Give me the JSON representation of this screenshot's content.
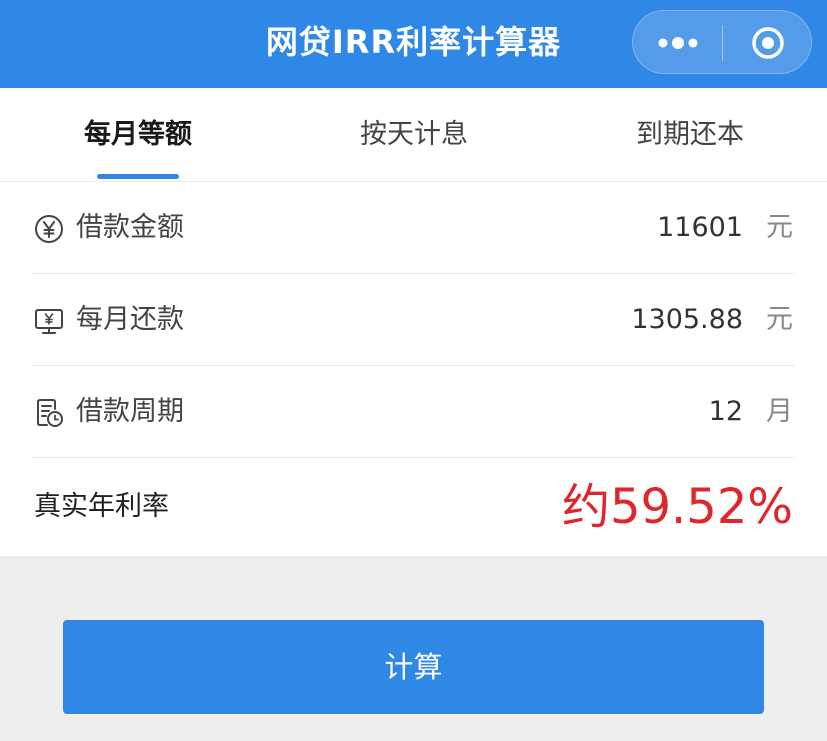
{
  "header": {
    "title": "网贷IRR利率计算器",
    "more_icon": "more-dots-icon",
    "close_icon": "target-close-icon"
  },
  "tabs": [
    {
      "label": "每月等额",
      "active": true
    },
    {
      "label": "按天计息",
      "active": false
    },
    {
      "label": "到期还本",
      "active": false
    }
  ],
  "form": {
    "loan_amount": {
      "icon": "yen-circle-icon",
      "label": "借款金额",
      "value": "11601",
      "unit": "元"
    },
    "monthly_payment": {
      "icon": "monitor-yen-icon",
      "label": "每月还款",
      "value": "1305.88",
      "unit": "元"
    },
    "loan_term": {
      "icon": "document-clock-icon",
      "label": "借款周期",
      "value": "12",
      "unit": "月"
    }
  },
  "result": {
    "label": "真实年利率",
    "value": "约59.52%"
  },
  "actions": {
    "calculate_label": "计算"
  },
  "colors": {
    "primary": "#2f87e6",
    "result_red": "#e0252b",
    "background": "#eeeeee"
  }
}
